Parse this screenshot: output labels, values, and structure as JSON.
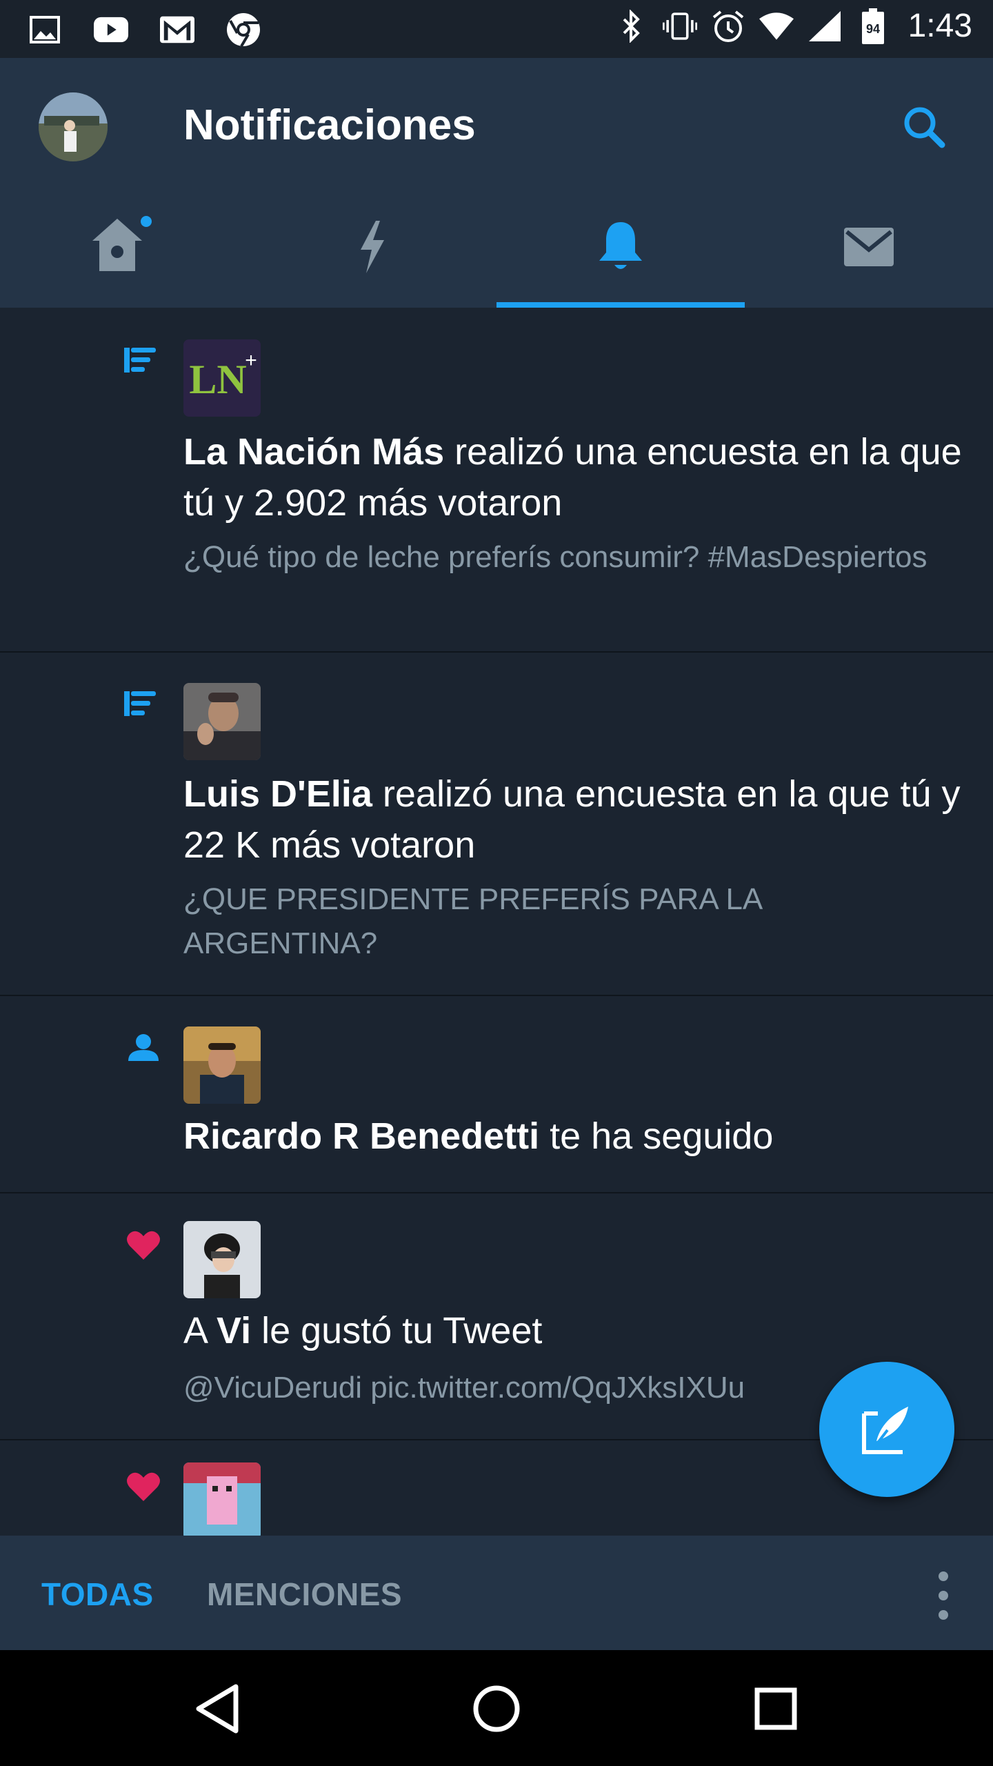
{
  "status_bar": {
    "time": "1:43",
    "battery_level": "94",
    "left_icons": [
      "gallery-icon",
      "youtube-icon",
      "gmail-icon",
      "chrome-icon"
    ],
    "right_icons": [
      "bluetooth-icon",
      "vibrate-icon",
      "alarm-icon",
      "wifi-icon",
      "signal-icon",
      "battery-icon"
    ]
  },
  "header": {
    "title": "Notificaciones"
  },
  "tabs": [
    {
      "name": "home",
      "icon": "home-icon",
      "has_dot": true,
      "active": false
    },
    {
      "name": "moments",
      "icon": "lightning-icon",
      "active": false
    },
    {
      "name": "notifications",
      "icon": "bell-icon",
      "active": true
    },
    {
      "name": "messages",
      "icon": "envelope-icon",
      "active": false
    }
  ],
  "notifications": [
    {
      "type_icon": "poll-icon",
      "avatar_text": "LN",
      "name": "La Nación Más",
      "action": " realizó una encuesta en la que tú y 2.902 más votaron",
      "detail": "¿Qué tipo de leche preferís consumir? #MasDespiertos"
    },
    {
      "type_icon": "poll-icon",
      "name": "Luis D'Elia",
      "action": " realizó una encuesta en la que tú y 22 K más votaron",
      "detail": "¿QUE PRESIDENTE PREFERÍS PARA LA ARGENTINA?"
    },
    {
      "type_icon": "follow-icon",
      "name": "Ricardo R Benedetti",
      "action": " te ha seguido",
      "detail": ""
    },
    {
      "type_icon": "heart-icon",
      "prefix": "A ",
      "name": "Vi",
      "action": " le gustó tu Tweet",
      "detail": "@VicuDerudi pic.twitter.com/QqJXksIXUu"
    },
    {
      "type_icon": "heart-icon",
      "name": "",
      "action": "",
      "detail": ""
    }
  ],
  "filters": {
    "all_label": "TODAS",
    "mentions_label": "MENCIONES"
  },
  "colors": {
    "accent": "#1da1f2",
    "header_bg": "#243447",
    "list_bg": "#1b2430",
    "heart": "#e0245e",
    "secondary_text": "#8899a6"
  }
}
